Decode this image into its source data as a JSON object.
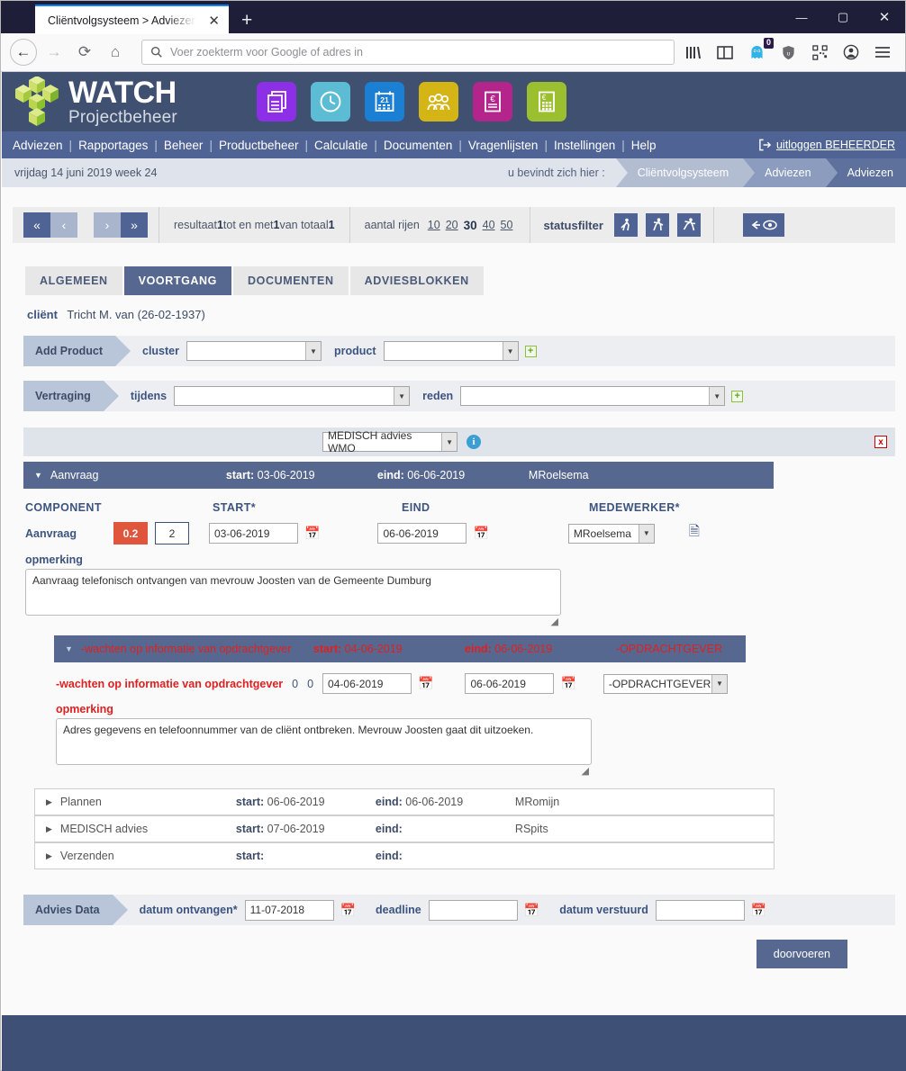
{
  "browser": {
    "tab_title": "Cliëntvolgsysteem > Adviezen > Ad",
    "tab_close": "✕",
    "new_tab": "+",
    "back": "←",
    "forward": "→",
    "reload": "⟳",
    "home": "⌂",
    "url_placeholder": "Voer zoekterm voor Google of adres in",
    "search_icon": "🔍",
    "extension_badge": "0",
    "win_minimize": "—",
    "win_maximize": "▢",
    "win_close": "✕"
  },
  "app": {
    "logo_main": "WATCH",
    "logo_sub": "Projectbeheer",
    "quick_icons": [
      {
        "name": "documents-icon",
        "color": "#8c2fe6"
      },
      {
        "name": "clock-icon",
        "color": "#5bbcd4"
      },
      {
        "name": "calendar-icon",
        "color": "#1b7fd4",
        "label": "21"
      },
      {
        "name": "people-icon",
        "color": "#d5b516"
      },
      {
        "name": "invoice-euro-icon",
        "color": "#b4258c"
      },
      {
        "name": "calculator-euro-icon",
        "color": "#9cbf2f"
      }
    ],
    "menu": [
      "Adviezen",
      "Rapportages",
      "Beheer",
      "Productbeheer",
      "Calculatie",
      "Documenten",
      "Vragenlijsten",
      "Instellingen",
      "Help"
    ],
    "menu_separator": "|",
    "logout_label": "uitloggen BEHEERDER",
    "logout_icon": "⇥",
    "date_line": "vrijdag 14 juni 2019   week 24",
    "you_are_here": "u bevindt zich hier :",
    "breadcrumbs": [
      "Cliëntvolgsysteem",
      "Adviezen",
      "Adviezen"
    ]
  },
  "pager": {
    "first": "«",
    "prev": "‹",
    "next": "›",
    "last": "»",
    "result_prefix": "resultaat ",
    "result_from": "1",
    "result_mid": " tot en met ",
    "result_to": "1",
    "result_of": " van totaal ",
    "result_total": "1",
    "rows_label": "aantal rijen",
    "rows_options": [
      "10",
      "20",
      "30",
      "40",
      "50"
    ],
    "rows_selected": "30",
    "statusfilter_label": "statusfilter",
    "status_icons": [
      "walker-icon",
      "runner-icon",
      "sprinter-icon"
    ],
    "eye_button": "eye-back-button"
  },
  "tabs": [
    {
      "label": "ALGEMEEN",
      "active": false
    },
    {
      "label": "VOORTGANG",
      "active": true
    },
    {
      "label": "DOCUMENTEN",
      "active": false
    },
    {
      "label": "ADVIESBLOKKEN",
      "active": false
    }
  ],
  "client": {
    "label": "cliënt",
    "value": "Tricht M. van (26-02-1937)"
  },
  "add_product": {
    "tag": "Add Product",
    "cluster_label": "cluster",
    "cluster_value": "",
    "product_label": "product",
    "product_value": "",
    "add_icon": "+"
  },
  "vertraging": {
    "tag": "Vertraging",
    "tijdens_label": "tijdens",
    "tijdens_value": "",
    "reden_label": "reden",
    "reden_value": "",
    "add_icon": "+"
  },
  "advies": {
    "type_value": "MEDISCH advies WMO",
    "info_icon": "i",
    "delete_icon": "x"
  },
  "aanvraag": {
    "title": "Aanvraag",
    "start_label": "start:",
    "start_value": "03-06-2019",
    "eind_label": "eind:",
    "eind_value": "06-06-2019",
    "medewerker": "MRoelsema",
    "headers": {
      "component": "COMPONENT",
      "start": "START*",
      "eind": "EIND",
      "medewerker": "MEDEWERKER*"
    },
    "row": {
      "component": "Aanvraag",
      "hours_badge": "0.2",
      "days": "2",
      "start": "03-06-2019",
      "eind": "06-06-2019",
      "medewerker": "MRoelsema"
    },
    "opmerking_label": "opmerking",
    "opmerking_value": "Aanvraag telefonisch ontvangen van mevrouw Joosten van de Gemeente Dumburg"
  },
  "wachten": {
    "title": "-wachten op informatie van opdrachtgever",
    "start_label": "start:",
    "start_value": "04-06-2019",
    "eind_label": "eind:",
    "eind_value": "06-06-2019",
    "opdrachtgever": "-OPDRACHTGEVER",
    "row": {
      "label": "-wachten op informatie van opdrachtgever",
      "val1": "0",
      "val2": "0",
      "start": "04-06-2019",
      "eind": "06-06-2019",
      "select": "-OPDRACHTGEVER"
    },
    "opmerking_label": "opmerking",
    "opmerking_value": "Adres gegevens en telefoonnummer van de cliënt ontbreken. Mevrouw Joosten gaat dit uitzoeken."
  },
  "collapsed_rows": [
    {
      "name": "Plannen",
      "start_label": "start:",
      "start": "06-06-2019",
      "eind_label": "eind:",
      "eind": "06-06-2019",
      "medewerker": "MRomijn"
    },
    {
      "name": "MEDISCH advies",
      "start_label": "start:",
      "start": "07-06-2019",
      "eind_label": "eind:",
      "eind": "",
      "medewerker": "RSpits"
    },
    {
      "name": "Verzenden",
      "start_label": "start:",
      "start": "",
      "eind_label": "eind:",
      "eind": "",
      "medewerker": ""
    }
  ],
  "advies_data": {
    "tag": "Advies Data",
    "ontvangen_label": "datum ontvangen*",
    "ontvangen_value": "11-07-2018",
    "deadline_label": "deadline",
    "deadline_value": "",
    "verstuurd_label": "datum verstuurd",
    "verstuurd_value": ""
  },
  "submit_label": "doorvoeren",
  "colors": {
    "app_header": "#3f5070",
    "menu_bar": "#4f6494",
    "accent": "#56688f",
    "badge_orange": "#e0563c",
    "alert_red": "#e02020",
    "footer": "#3e5075"
  }
}
